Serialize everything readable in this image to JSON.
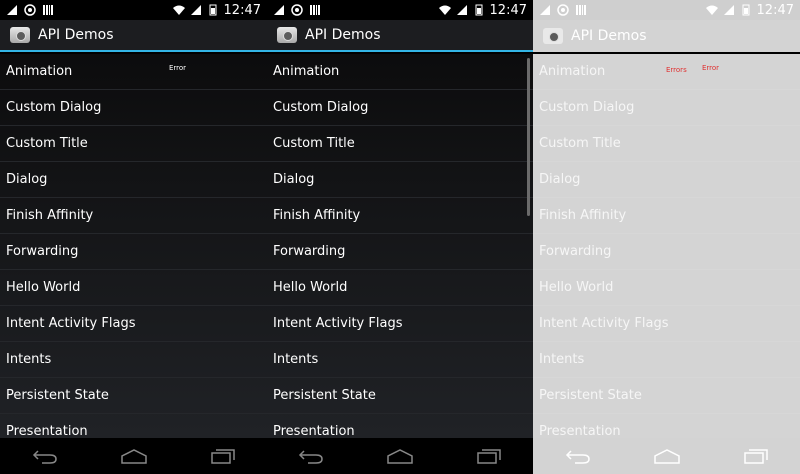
{
  "screens": [
    {
      "status_time": "12:47",
      "app_title": "API Demos",
      "items": [
        "Animation",
        "Custom Dialog",
        "Custom Title",
        "Dialog",
        "Finish Affinity",
        "Forwarding",
        "Hello World",
        "Intent Activity Flags",
        "Intents",
        "Persistent State",
        "Presentation"
      ],
      "error_labels": [
        "Error"
      ]
    },
    {
      "status_time": "12:47",
      "app_title": "API Demos",
      "items": [
        "Animation",
        "Custom Dialog",
        "Custom Title",
        "Dialog",
        "Finish Affinity",
        "Forwarding",
        "Hello World",
        "Intent Activity Flags",
        "Intents",
        "Persistent State",
        "Presentation"
      ],
      "error_labels": []
    },
    {
      "status_time": "12:47",
      "app_title": "API Demos",
      "items": [
        "Animation",
        "Custom Dialog",
        "Custom Title",
        "Dialog",
        "Finish Affinity",
        "Forwarding",
        "Hello World",
        "Intent Activity Flags",
        "Intents",
        "Persistent State",
        "Presentation"
      ],
      "error_labels": [
        "Errors",
        "Error"
      ]
    }
  ],
  "icons": {
    "status_left": [
      "notification-icon",
      "whatsapp-icon",
      "barcode-icon"
    ],
    "status_right": [
      "wifi-icon",
      "signal-icon",
      "battery-icon"
    ],
    "nav": [
      "back-icon",
      "home-icon",
      "recents-icon"
    ]
  },
  "colors": {
    "accent": "#33b5e5",
    "error_red": "#e03030"
  }
}
